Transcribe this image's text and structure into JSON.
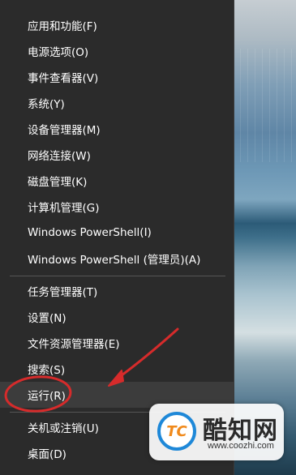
{
  "menu": {
    "group1": [
      {
        "label": "应用和功能(F)"
      },
      {
        "label": "电源选项(O)"
      },
      {
        "label": "事件查看器(V)"
      },
      {
        "label": "系统(Y)"
      },
      {
        "label": "设备管理器(M)"
      },
      {
        "label": "网络连接(W)"
      },
      {
        "label": "磁盘管理(K)"
      },
      {
        "label": "计算机管理(G)"
      },
      {
        "label": "Windows PowerShell(I)"
      },
      {
        "label": "Windows PowerShell (管理员)(A)"
      }
    ],
    "group2": [
      {
        "label": "任务管理器(T)"
      },
      {
        "label": "设置(N)"
      },
      {
        "label": "文件资源管理器(E)"
      },
      {
        "label": "搜索(S)"
      },
      {
        "label": "运行(R)",
        "highlighted": true
      }
    ],
    "group3": [
      {
        "label": "关机或注销(U)"
      },
      {
        "label": "桌面(D)"
      }
    ]
  },
  "annotation": {
    "circle_color": "#d62b2b",
    "arrow_color": "#d62b2b"
  },
  "watermark": {
    "icon": "tc-logo-icon",
    "mark_text": "TC",
    "name": "酷知网",
    "url": "www.coozhi.com"
  }
}
